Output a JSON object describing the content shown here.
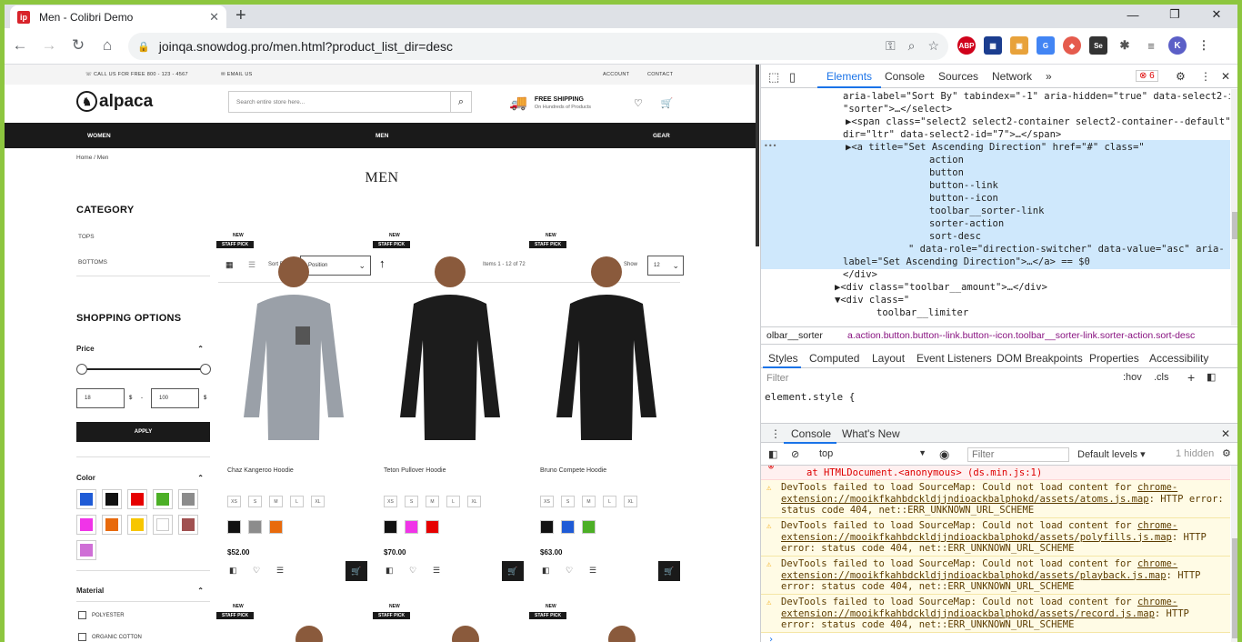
{
  "browser": {
    "tab_title": "Men - Colibri Demo",
    "favicon": "ip",
    "url": "joinqa.snowdog.pro/men.html?product_list_dir=desc"
  },
  "site": {
    "util": {
      "phone": "CALL US FOR FREE 800 - 123 - 4567",
      "email": "EMAIL US",
      "account": "ACCOUNT",
      "contact": "CONTACT"
    },
    "logo": "alpaca",
    "search_placeholder": "Search entire store here...",
    "shipping_title": "FREE SHIPPING",
    "shipping_sub": "On Hundreds of Products",
    "nav": [
      "WOMEN",
      "MEN",
      "GEAR"
    ],
    "breadcrumb": {
      "home": "Home",
      "sep": "/",
      "current": "Men"
    },
    "page_title": "MEN",
    "sidebar": {
      "category": "CATEGORY",
      "cat_items": [
        "TOPS",
        "BOTTOMS"
      ],
      "shopping": "SHOPPING OPTIONS",
      "price": "Price",
      "min": "18",
      "max": "100",
      "currency": "$",
      "dash": "-",
      "apply": "APPLY",
      "color": "Color",
      "material": "Material",
      "materials": [
        "POLYESTER",
        "ORGANIC COTTON"
      ]
    },
    "toolbar": {
      "sort_by": "Sort By",
      "sort_value": "Position",
      "items": "Items 1 - 12 of 72",
      "show": "Show",
      "limit": "12"
    },
    "swatches": [
      "#1f5bd6",
      "#111111",
      "#e60000",
      "#4caf26",
      "#8c8c8c",
      "#f034e8",
      "#e86a0c",
      "#f7c600",
      "#ffffff",
      "#a05050",
      "#cf6fd6"
    ],
    "products": [
      {
        "badge_new": "NEW",
        "badge_pick": "STAFF PICK",
        "name": "Chaz Kangeroo Hoodie",
        "sizes": [
          "XS",
          "S",
          "M",
          "L",
          "XL"
        ],
        "colors": [
          "#111111",
          "#8c8c8c",
          "#e86a0c"
        ],
        "price": "$52.00"
      },
      {
        "badge_new": "NEW",
        "badge_pick": "STAFF PICK",
        "name": "Teton Pullover Hoodie",
        "sizes": [
          "XS",
          "S",
          "M",
          "L",
          "XL"
        ],
        "colors": [
          "#111111",
          "#f034e8",
          "#e60000"
        ],
        "price": "$70.00"
      },
      {
        "badge_new": "NEW",
        "badge_pick": "STAFF PICK",
        "name": "Bruno Compete Hoodie",
        "sizes": [
          "XS",
          "S",
          "M",
          "L",
          "XL"
        ],
        "colors": [
          "#111111",
          "#1f5bd6",
          "#4caf26"
        ],
        "price": "$63.00"
      }
    ],
    "row2_badges": {
      "new": "NEW",
      "pick": "STAFF PICK"
    }
  },
  "devtools": {
    "tabs": [
      "Elements",
      "Console",
      "Sources",
      "Network"
    ],
    "more": "»",
    "errors": "6",
    "lines": [
      "aria-label=\"Sort By\" tabindex=\"-1\" aria-hidden=\"true\" data-select2-id=",
      "\"sorter\">…</select>",
      "▶<span class=\"select2 select2-container select2-container--default\"",
      "dir=\"ltr\" data-select2-id=\"7\">…</span>",
      "▶<a title=\"Set Ascending Direction\" href=\"#\" class=\"",
      "action",
      "button",
      "button--link",
      "button--icon",
      "toolbar__sorter-link",
      "sorter-action",
      "sort-desc",
      "\" data-role=\"direction-switcher\" data-value=\"asc\" aria-",
      "label=\"Set Ascending Direction\">…</a> == $0",
      "</div>",
      "▶<div class=\"toolbar__amount\">…</div>",
      "▼<div class=\"",
      "toolbar__limiter"
    ],
    "crumbs": [
      "olbar__sorter",
      "a.action.button.button--link.button--icon.toolbar__sorter-link.sorter-action.sort-desc"
    ],
    "style_tabs": [
      "Styles",
      "Computed",
      "Layout",
      "Event Listeners",
      "DOM Breakpoints",
      "Properties",
      "Accessibility"
    ],
    "filter": "Filter",
    "hov": ":hov",
    ".cls": ".cls",
    "element_style": "element.style {",
    "console_tabs": [
      "Console",
      "What's New"
    ],
    "context": "top",
    "console_filter": "Filter",
    "levels": "Default levels ▾",
    "hidden": "1 hidden",
    "error_line": "at HTMLDocument.<anonymous> (ds.min.js:1)",
    "messages": [
      {
        "a": "DevTools failed to load SourceMap: Could not load content for ",
        "link": "chrome-extension://mooikfkahbdckldjjndioackbalphokd/assets/atoms.js.map",
        "b": ": HTTP error: status code 404, net::ERR_UNKNOWN_URL_SCHEME"
      },
      {
        "a": "DevTools failed to load SourceMap: Could not load content for ",
        "link": "chrome-extension://mooikfkahbdckldjjndioackbalphokd/assets/polyfills.js.map",
        "b": ": HTTP error: status code 404, net::ERR_UNKNOWN_URL_SCHEME"
      },
      {
        "a": "DevTools failed to load SourceMap: Could not load content for ",
        "link": "chrome-extension://mooikfkahbdckldjjndioackbalphokd/assets/playback.js.map",
        "b": ": HTTP error: status code 404, net::ERR_UNKNOWN_URL_SCHEME"
      },
      {
        "a": "DevTools failed to load SourceMap: Could not load content for ",
        "link": "chrome-extension://mooikfkahbdckldjjndioackbalphokd/assets/record.js.map",
        "b": ": HTTP error: status code 404, net::ERR_UNKNOWN_URL_SCHEME"
      }
    ]
  }
}
